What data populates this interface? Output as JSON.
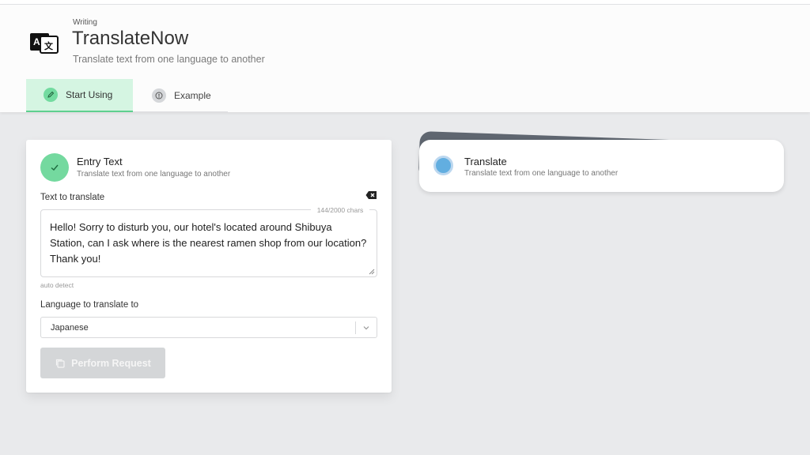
{
  "app": {
    "category": "Writing",
    "title": "TranslateNow",
    "subtitle": "Translate text from one language to another"
  },
  "tabs": [
    {
      "label": "Start Using",
      "active": true,
      "icon": "pencil-icon"
    },
    {
      "label": "Example",
      "active": false,
      "icon": "info-icon"
    }
  ],
  "entry_card": {
    "title": "Entry Text",
    "subtitle": "Translate text from one language to another",
    "text_label": "Text to translate",
    "char_count": "144/2000 chars",
    "text_value": "Hello! Sorry to disturb you, our hotel's located around Shibuya Station, can I ask where is the nearest ramen shop from our location? Thank you!",
    "detect_hint": "auto detect",
    "lang_label": "Language to translate to",
    "lang_value": "Japanese",
    "button_label": "Perform Request"
  },
  "translate_card": {
    "title": "Translate",
    "subtitle": "Translate text from one language to another"
  },
  "colors": {
    "accent_green": "#74d99f",
    "tab_active_bg": "#d5f5e2",
    "pending_blue": "#62aee0",
    "button_disabled": "#d4d6d8"
  }
}
